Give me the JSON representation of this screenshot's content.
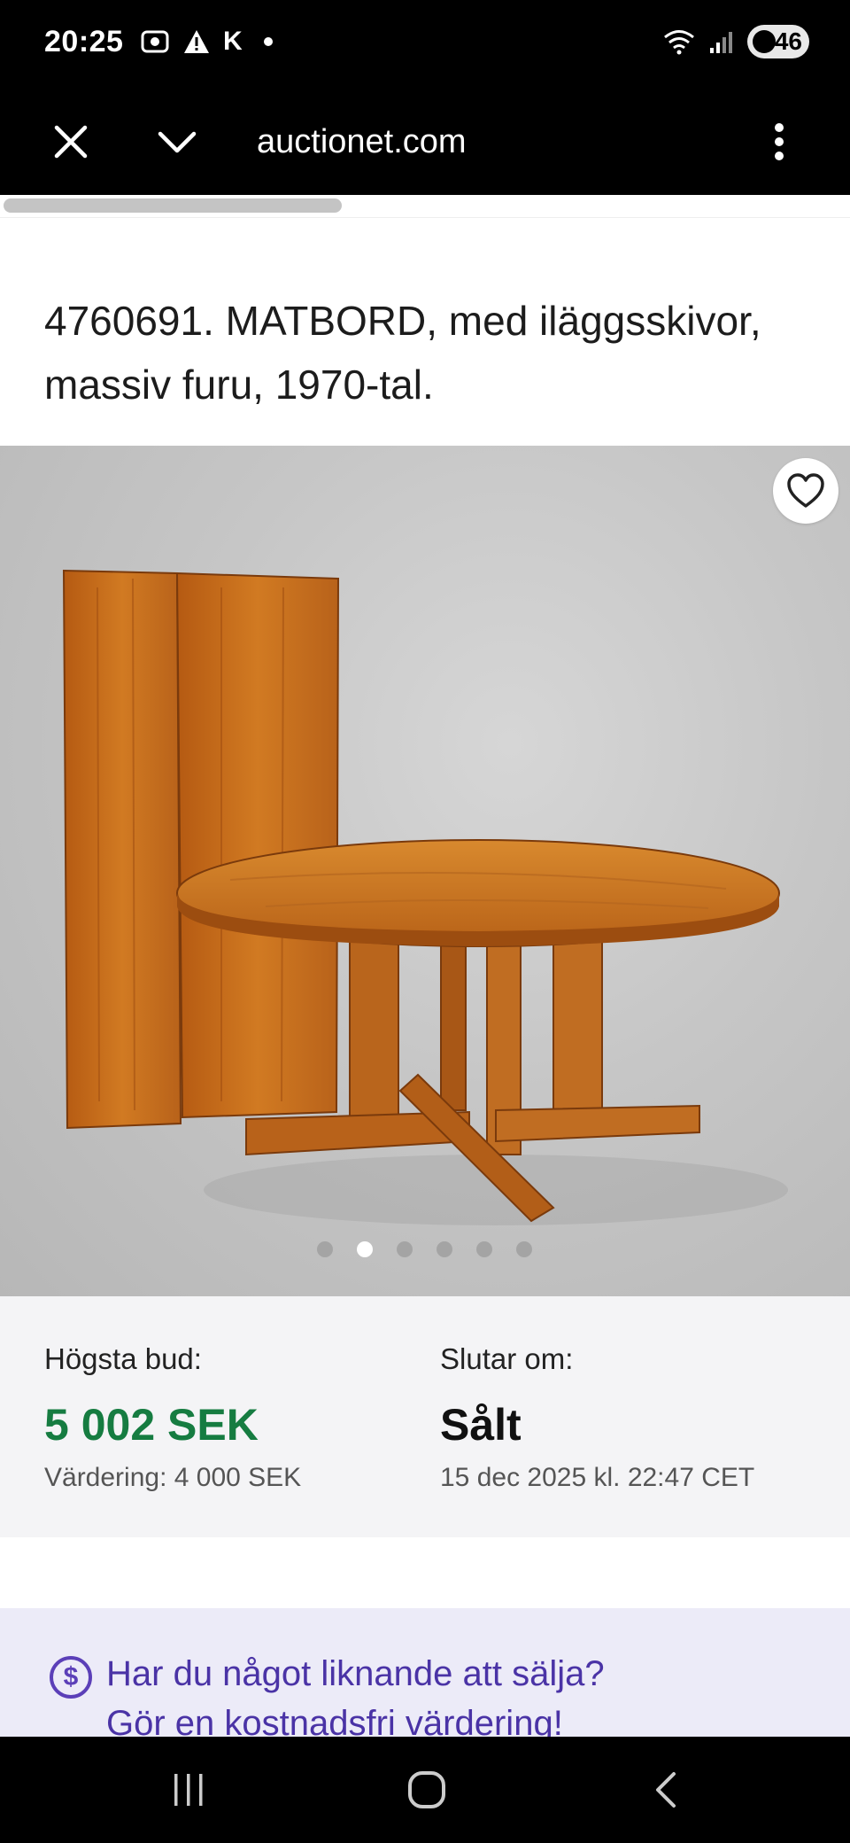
{
  "status_bar": {
    "time": "20:25",
    "left_icons": [
      "screenshot-icon",
      "warning-icon"
    ],
    "k_label": "K",
    "battery": "46"
  },
  "browser": {
    "url": "auctionet.com",
    "icons": [
      "close-icon",
      "chevron-down-icon",
      "more-vert-icon"
    ]
  },
  "item": {
    "title": "4760691. MATBORD, med iläggsskivor, massiv furu, 1970-tal."
  },
  "gallery": {
    "image_count": 6,
    "active_index": 2
  },
  "bid": {
    "highest_label": "Högsta bud:",
    "highest_value": "5 002 SEK",
    "estimate": "Värdering: 4 000 SEK",
    "ends_label": "Slutar om:",
    "ends_value": "Sålt",
    "end_time": "15 dec 2025 kl. 22:47 CET"
  },
  "sell": {
    "line1": "Har du något liknande att sälja?",
    "line2": "Gör en kostnadsfri värdering!"
  },
  "colors": {
    "price_green": "#167c41",
    "sell_purple": "#4a33a6"
  }
}
